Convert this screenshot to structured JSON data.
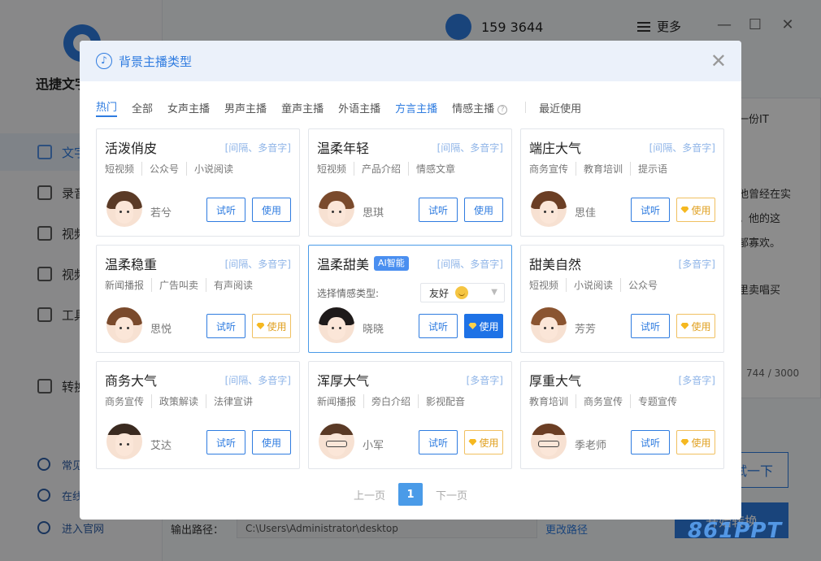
{
  "app": {
    "title": "迅捷文字",
    "sidebar": [
      "文字",
      "录音",
      "视频",
      "视频",
      "工具"
    ],
    "sidebar_extra": "转换",
    "sidebar_bottom": [
      "常见",
      "在线",
      "进入官网"
    ],
    "phone": "159 3644",
    "more": "更多",
    "editor_lines": [
      "一份IT",
      "他曾经在实",
      "。他的这",
      "郁寡欢。",
      "里卖唱买"
    ],
    "counter": "744 / 3000",
    "btn_outline": "试一下",
    "btn_solid": "开始转换",
    "output_label": "输出路径：",
    "output_path": "C:\\Users\\Administrator\\desktop",
    "change_path": "更改路径",
    "watermark": "861PPT"
  },
  "modal": {
    "title": "背景主播类型",
    "tabs": [
      "热门",
      "全部",
      "女声主播",
      "男声主播",
      "童声主播",
      "外语主播",
      "方言主播",
      "情感主播",
      "最近使用"
    ],
    "cards": [
      {
        "title": "活泼俏皮",
        "meta": "[间隔、多音字]",
        "tags": [
          "短视频",
          "公众号",
          "小说阅读"
        ],
        "name": "若兮",
        "listen": "试听",
        "use": "使用"
      },
      {
        "title": "温柔年轻",
        "meta": "[间隔、多音字]",
        "tags": [
          "短视频",
          "产品介绍",
          "情感文章"
        ],
        "name": "思琪",
        "listen": "试听",
        "use": "使用"
      },
      {
        "title": "端庄大气",
        "meta": "[间隔、多音字]",
        "tags": [
          "商务宣传",
          "教育培训",
          "提示语"
        ],
        "name": "思佳",
        "listen": "试听",
        "use": "使用"
      },
      {
        "title": "温柔稳重",
        "meta": "[间隔、多音字]",
        "tags": [
          "新闻播报",
          "广告叫卖",
          "有声阅读"
        ],
        "name": "思悦",
        "listen": "试听",
        "use": "使用"
      },
      {
        "title": "温柔甜美",
        "badge": "AI智能",
        "meta": "[间隔、多音字]",
        "emotion_label": "选择情感类型:",
        "emotion_value": "友好",
        "name": "晓晓",
        "listen": "试听",
        "use": "使用"
      },
      {
        "title": "甜美自然",
        "meta": "[多音字]",
        "tags": [
          "短视频",
          "小说阅读",
          "公众号"
        ],
        "name": "芳芳",
        "listen": "试听",
        "use": "使用"
      },
      {
        "title": "商务大气",
        "meta": "[间隔、多音字]",
        "tags": [
          "商务宣传",
          "政策解读",
          "法律宣讲"
        ],
        "name": "艾达",
        "listen": "试听",
        "use": "使用"
      },
      {
        "title": "浑厚大气",
        "meta": "[多音字]",
        "tags": [
          "新闻播报",
          "旁白介绍",
          "影视配音"
        ],
        "name": "小军",
        "listen": "试听",
        "use": "使用"
      },
      {
        "title": "厚重大气",
        "meta": "[多音字]",
        "tags": [
          "教育培训",
          "商务宣传",
          "专题宣传"
        ],
        "name": "季老师",
        "listen": "试听",
        "use": "使用"
      }
    ],
    "pager": {
      "prev": "上一页",
      "current": "1",
      "next": "下一页"
    }
  },
  "colors": {
    "accent": "#2f7ce0",
    "vip": "#f0c060",
    "overlay": "rgba(0,0,0,0.45)"
  }
}
